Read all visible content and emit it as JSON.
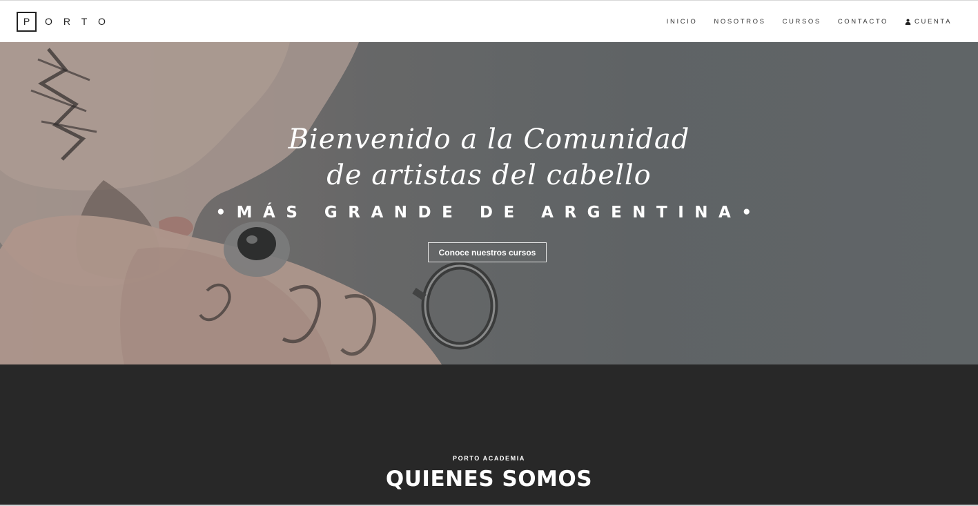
{
  "header": {
    "logo_box_letter": "P",
    "logo_rest": "ORTO",
    "nav": [
      {
        "label": "INICIO"
      },
      {
        "label": "NOSOTROS"
      },
      {
        "label": "CURSOS"
      },
      {
        "label": "CONTACTO"
      },
      {
        "label": "CUENTA",
        "icon": "user-icon"
      }
    ]
  },
  "hero": {
    "script_line_1": "Bienvenido a la Comunidad",
    "script_line_2": "de artistas del cabello",
    "spaced_title": "•MÁS GRANDE DE ARGENTINA•",
    "button_label": "Conoce nuestros cursos"
  },
  "about": {
    "eyebrow": "PORTO ACADEMIA",
    "title": "QUIENES SOMOS"
  },
  "colors": {
    "header_bg": "#ffffff",
    "hero_bg": "#6a6e70",
    "about_bg": "#282828",
    "text_light": "#ffffff",
    "text_dark": "#333333"
  }
}
